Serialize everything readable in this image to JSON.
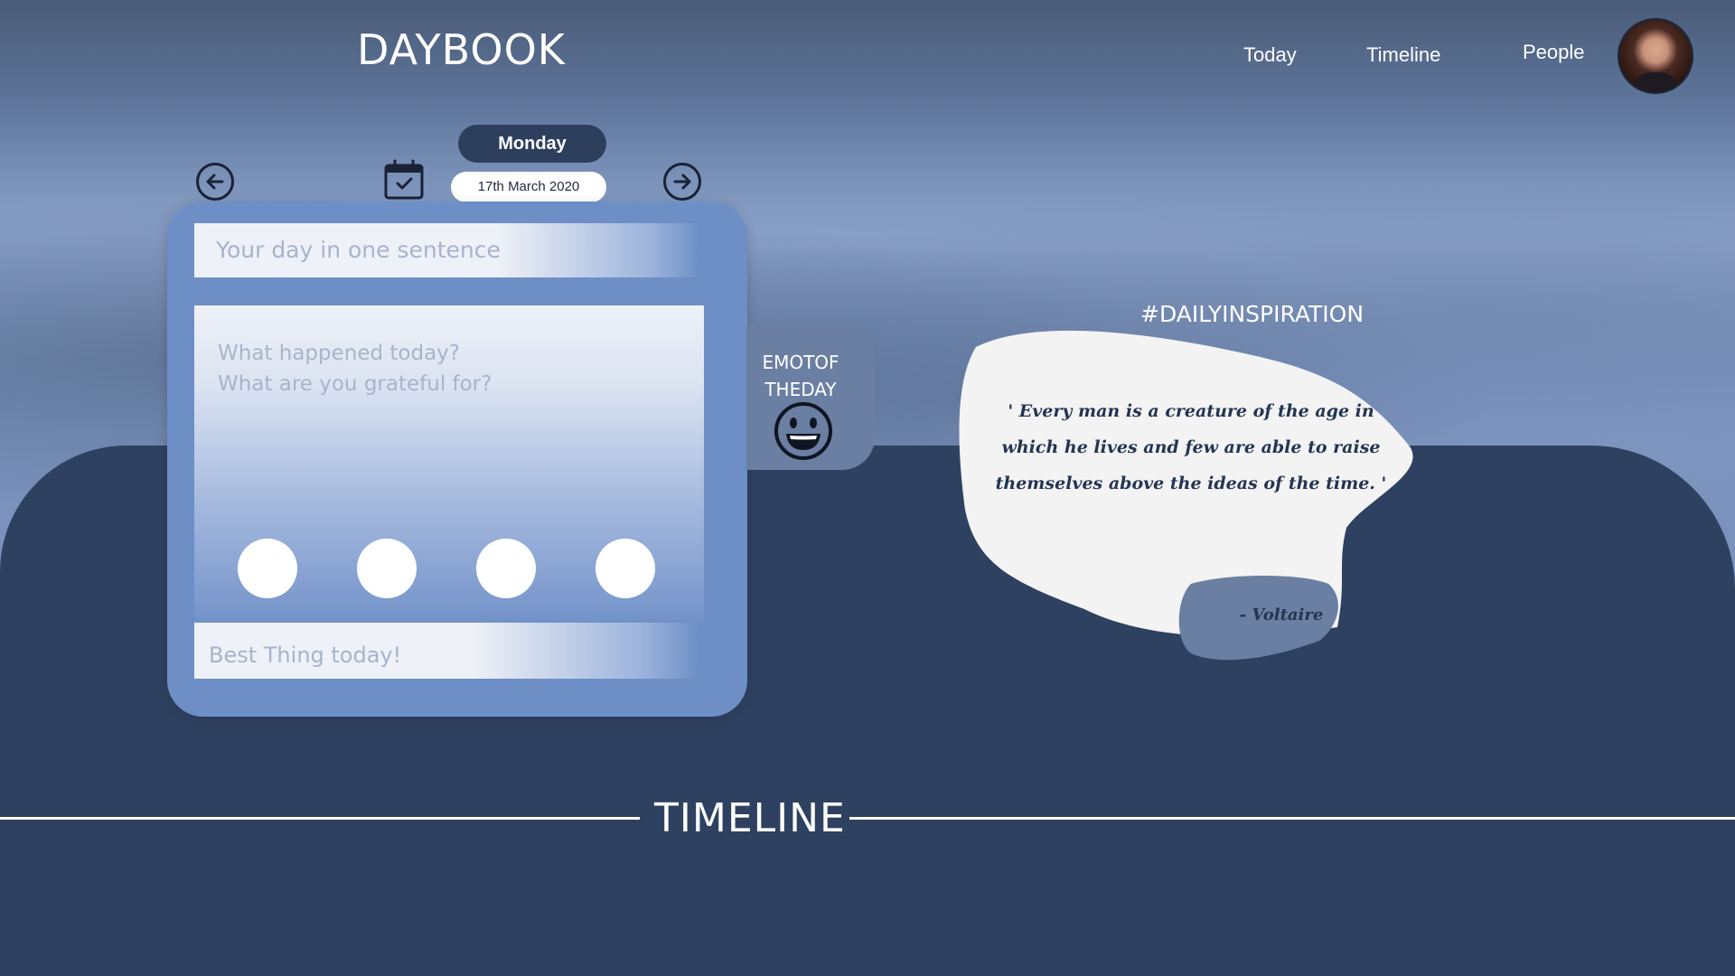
{
  "app": {
    "title": "DAYBOOK"
  },
  "nav": {
    "items": [
      {
        "label": "Today"
      },
      {
        "label": "Timeline"
      },
      {
        "label": "People"
      }
    ]
  },
  "date_picker": {
    "day": "Monday",
    "date": "17th March 2020",
    "prev_icon": "arrow-left-icon",
    "next_icon": "arrow-right-icon",
    "calendar_icon": "calendar-check-icon"
  },
  "journal": {
    "sentence_placeholder": "Your day in one sentence",
    "body_placeholder_line1": "What happened today?",
    "body_placeholder_line2": "What are you grateful for?",
    "best_thing_placeholder": "Best Thing today!",
    "photo_slots": 4
  },
  "emote": {
    "label_line1": "EMOTOF",
    "label_line2": "THEDAY",
    "icon": "grinning-face-icon"
  },
  "inspiration": {
    "title": "#DAILYINSPIRATION",
    "quote": "' Every man is a creature of the age in which he lives and few are able to raise themselves above the ideas of the time. '",
    "author": "- Voltaire"
  },
  "timeline": {
    "title": "TIMELINE"
  },
  "colors": {
    "card": "#6d8fc6",
    "dark_panel": "#2e4160",
    "pill_dark": "#2d3f5c",
    "emote_tab": "#6a7fa2",
    "quote_bubble": "#f3f3f4",
    "author_bubble": "#6a7fa2"
  }
}
